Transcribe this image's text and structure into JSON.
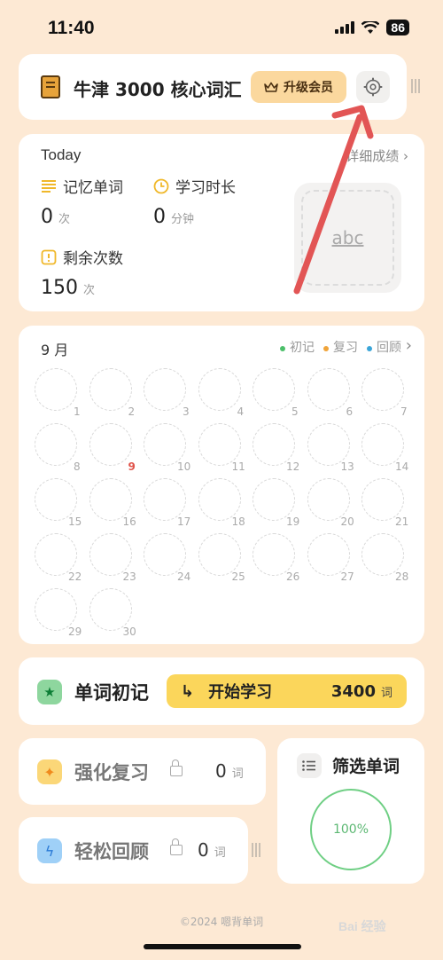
{
  "status_bar": {
    "time": "11:40",
    "battery": "86"
  },
  "header": {
    "book_title": "牛津 3000 核心词汇",
    "vip_label": "升级会员"
  },
  "today": {
    "label": "Today",
    "detail_link": "详细成绩",
    "memorized_label": "记忆单词",
    "memorized_value": "0",
    "memorized_unit": "次",
    "duration_label": "学习时长",
    "duration_value": "0",
    "duration_unit": "分钟",
    "remaining_label": "剩余次数",
    "remaining_value": "150",
    "remaining_unit": "次",
    "preview_word": "abc"
  },
  "calendar": {
    "month": "9 月",
    "legend": [
      {
        "label": "初记",
        "color": "#4cbf6a"
      },
      {
        "label": "复习",
        "color": "#f0a43a"
      },
      {
        "label": "回顾",
        "color": "#3aa5d8"
      }
    ],
    "today": "9",
    "days": [
      "1",
      "2",
      "3",
      "4",
      "5",
      "6",
      "7",
      "8",
      "9",
      "10",
      "11",
      "12",
      "13",
      "14",
      "15",
      "16",
      "17",
      "18",
      "19",
      "20",
      "21",
      "22",
      "23",
      "24",
      "25",
      "26",
      "27",
      "28",
      "29",
      "30"
    ]
  },
  "learn": {
    "title": "单词初记",
    "start_label": "开始学习",
    "count": "3400",
    "unit": "词"
  },
  "review": {
    "title": "强化复习",
    "count": "0",
    "unit": "词"
  },
  "relax": {
    "title": "轻松回顾",
    "count": "0",
    "unit": "词"
  },
  "filter": {
    "title": "筛选单词",
    "progress": "100%"
  },
  "footer": {
    "copyright": "©2024 嗯背单词",
    "watermark": "Bai 经验"
  }
}
